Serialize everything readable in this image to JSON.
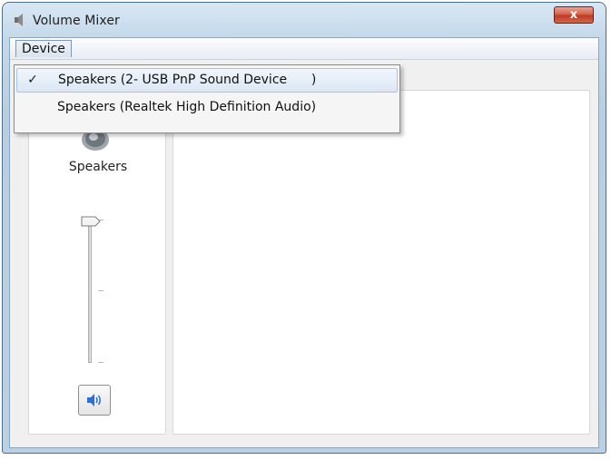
{
  "window": {
    "title": "Volume Mixer",
    "close_label": "x"
  },
  "menubar": {
    "device_label": "Device"
  },
  "device_menu": {
    "items": [
      {
        "label": "Speakers (2- USB PnP Sound Device      )",
        "checked": true,
        "check_glyph": "✓"
      },
      {
        "label": "Speakers (Realtek High Definition Audio)",
        "checked": false,
        "check_glyph": ""
      }
    ]
  },
  "device": {
    "label": "Speakers",
    "volume_fraction": 1.0,
    "icon": "speaker-icon"
  },
  "mute": {
    "icon": "speaker-volume-icon"
  },
  "colors": {
    "accent": "#2a6fd6",
    "close": "#c0392b"
  }
}
